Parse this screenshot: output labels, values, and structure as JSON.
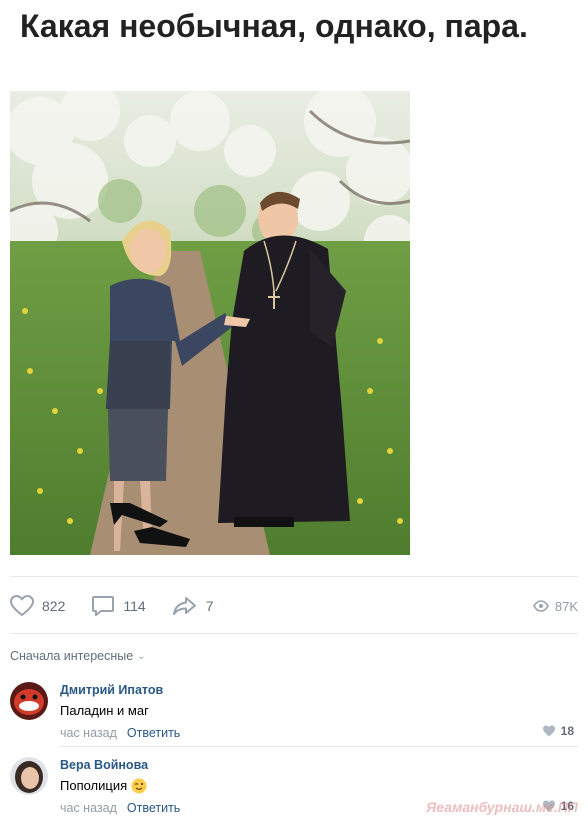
{
  "post": {
    "title": "Какая необычная, однако, пара."
  },
  "actions": {
    "likes": "822",
    "comments": "114",
    "shares": "7",
    "views": "87K"
  },
  "comments_sort": "Сначала интересные",
  "comments": [
    {
      "author": "Дмитрий Ипатов",
      "text": "Паладин и маг",
      "time": "час назад",
      "reply_label": "Ответить",
      "likes": "18"
    },
    {
      "author": "Вера Войнова",
      "text": "Пополиция",
      "time": "час назад",
      "reply_label": "Ответить",
      "likes": "16"
    }
  ],
  "watermark": "Яеаманбурнаш.ме.ПП",
  "colors": {
    "link": "#2a5885",
    "muted": "#939ba5",
    "icon": "#99a2ad"
  },
  "icons": [
    "heart-icon",
    "comment-icon",
    "share-icon",
    "eye-icon",
    "chevron-down-icon",
    "wink-emoji-icon"
  ]
}
